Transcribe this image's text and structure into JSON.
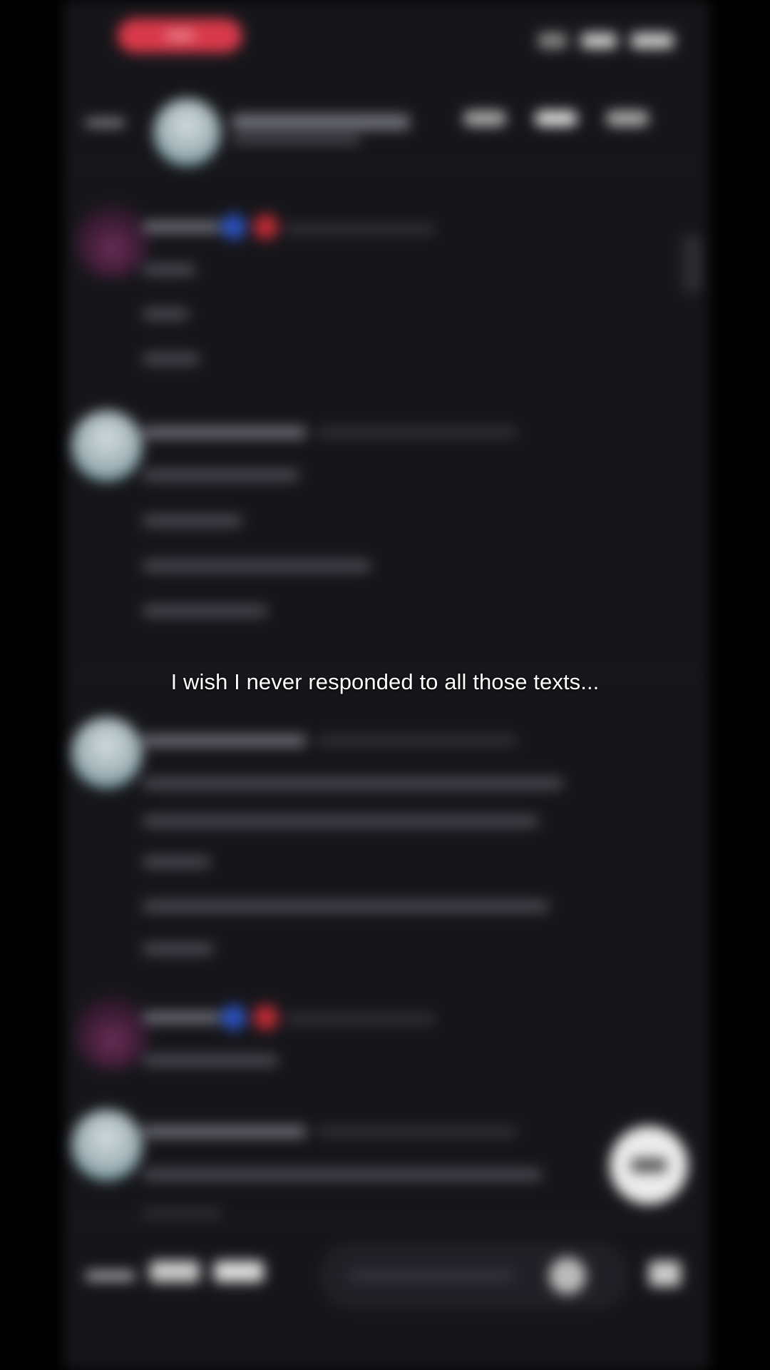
{
  "overlay": {
    "caption": "I wish I never responded to all those texts..."
  },
  "background": {
    "description_hidden": true,
    "accent_color": "#d8394a",
    "surface_color": "#16161a"
  }
}
